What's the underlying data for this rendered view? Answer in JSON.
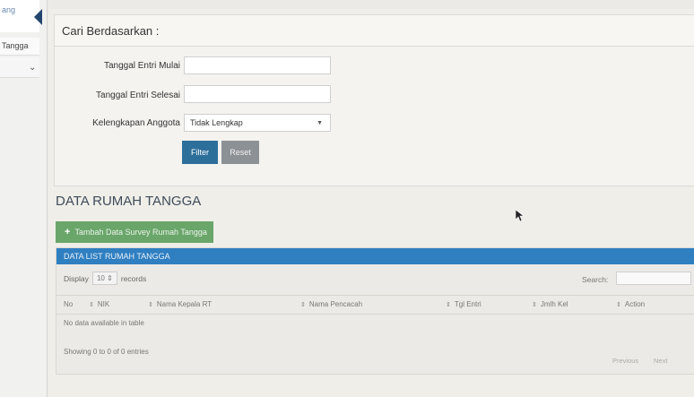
{
  "sidebar": {
    "items": [
      {
        "label": "ang"
      },
      {
        "label": "Tangga"
      }
    ]
  },
  "filter_panel": {
    "title": "Cari Berdasarkan :",
    "fields": {
      "tanggal_mulai_label": "Tanggal Entri Mulai",
      "tanggal_mulai_value": "",
      "tanggal_selesai_label": "Tanggal Entri Selesai",
      "tanggal_selesai_value": "",
      "kelengkapan_label": "Kelengkapan Anggota",
      "kelengkapan_value": "Tidak Lengkap"
    },
    "filter_label": "Filter",
    "reset_label": "Reset"
  },
  "section_title": "DATA RUMAH TANGGA",
  "add_button_label": "Tambah Data Survey Rumah Tangga",
  "table": {
    "bar_title": "DATA LIST RUMAH TANGGA",
    "display_label": "Display",
    "display_value": "10",
    "records_label": "records",
    "search_label": "Search:",
    "search_value": "",
    "columns": [
      "No",
      "NIK",
      "Nama Kepala RT",
      "Nama Pencacah",
      "Tgl Entri",
      "Jmlh Kel",
      "Action"
    ],
    "empty_message": "No data available in table",
    "showing_text": "Showing 0 to 0 of 0 entries",
    "prev_label": "Previous",
    "next_label": "Next"
  },
  "colors": {
    "primary": "#2d6f9b",
    "table_header": "#2f7fc1",
    "success": "#6aa66a",
    "reset": "#8c9196"
  },
  "icons": [
    "plus-icon",
    "chevron-down-icon",
    "sort-icon",
    "collapse-arrow-icon",
    "mouse-cursor-icon"
  ]
}
